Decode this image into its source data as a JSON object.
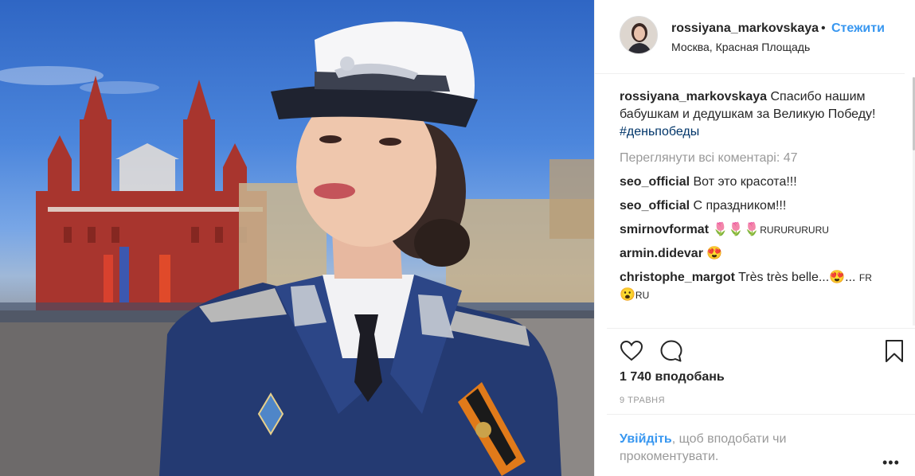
{
  "post": {
    "username": "rossiyana_markovskaya",
    "dot": "•",
    "follow_label": "Стежити",
    "location": "Москва, Красная Площадь",
    "caption_text": "Спасибо нашим бабушкам и дедушкам за Великую Победу!",
    "hashtag": "#деньпобеды",
    "view_all_comments": "Переглянути всі коментарі: 47",
    "comments": [
      {
        "user": "seo_official",
        "text": "Вот это красота!!!"
      },
      {
        "user": "seo_official",
        "text": "С праздником!!!"
      },
      {
        "user": "smirnovformat",
        "text": "🌷🌷🌷",
        "tail": "RURURURURU"
      },
      {
        "user": "armin.didevar",
        "text": "😍"
      },
      {
        "user": "christophe_margot",
        "text": "Très très belle...😍...",
        "tail": "FR",
        "line2": "😮",
        "line2_tail": "RU"
      }
    ],
    "likes": "1 740 вподобань",
    "date": "9 ТРАВНЯ",
    "login_link": "Увійдіть",
    "login_text": ", щоб вподобати чи прокоментувати.",
    "more": "•••"
  },
  "icons": [
    "heart-icon",
    "comment-icon",
    "bookmark-icon",
    "more-options-icon"
  ],
  "colors": {
    "link_blue": "#3897f0",
    "hashtag": "#003569",
    "muted": "#999999",
    "text": "#262626"
  }
}
